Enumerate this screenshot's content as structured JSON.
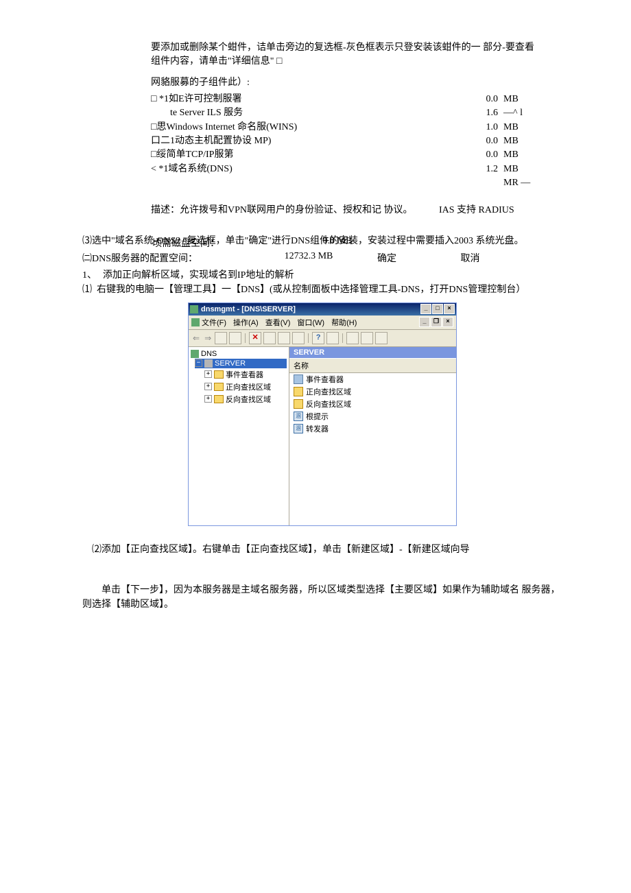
{
  "intro": {
    "p1": "要添加或删除某个蚶件，诘单击旁边的复选框-灰色框表示只登安装该蚶件的一 部分-要查看组件内容，请单击\"详细信息\" □",
    "p2": "网貉服募的子组件此）:"
  },
  "components": [
    {
      "label": "□ *1如E许可控制服署",
      "size": "0.0",
      "unit": "MB"
    },
    {
      "label": "　　te Server ILS 服务",
      "size": "1.6",
      "unit": "—^ l"
    },
    {
      "label": "□思Windows Internet 命名服(WINS)",
      "size": "1.0",
      "unit": "MB"
    },
    {
      "label": "口二1动态主机配置协设 MP)",
      "size": "0.0",
      "unit": "MB"
    },
    {
      "label": "□绥简单TCP/IP服第",
      "size": "0.0",
      "unit": "MB"
    },
    {
      "label": "< *1域名系统(DNS)",
      "size": "1.2",
      "unit": "MB"
    },
    {
      "label": "",
      "size": "",
      "unit": "MR —"
    }
  ],
  "desc": {
    "left": "描述：允许拨号和VPN联网用户的身份验证、授权和记 协议。",
    "right": "IAS 支持 RADIUS"
  },
  "step3": "⑶选中\"域名系统-ONS2 \"复选框，单击\"确定\"进行DNS组件的安装，安装过程中需要插入2003 系统光盘。",
  "diskReq": {
    "label": "顷需磁盘空间：",
    "val": "0.0 MB"
  },
  "diskCfg": {
    "label": "㈡DNS服务器的配置空间：",
    "val": "12732.3 MB"
  },
  "buttons": {
    "ok": "确定",
    "cancel": "取消"
  },
  "step1": {
    "num": "1、",
    "text": "添加正向解析区域，实现域名到IP地址的解析"
  },
  "sub1": "⑴ 右键我的电脑一【管理工具】一【DNS】(或从控制面板中选择管理工具-DNS，打开DNS管理控制台）",
  "app": {
    "title": "dnsmgmt - [DNS\\SERVER]",
    "menu": {
      "file": "文件(F)",
      "action": "操作(A)",
      "view": "查看(V)",
      "window": "窗口(W)",
      "help": "帮助(H)"
    },
    "tree": {
      "root": "DNS",
      "server": "SERVER",
      "nodes": [
        "事件查看器",
        "正向查找区域",
        "反向查找区域"
      ]
    },
    "list": {
      "header": "SERVER",
      "col": "名称",
      "items": [
        "事件查看器",
        "正向查找区域",
        "反向查找区域",
        "根提示",
        "转发器"
      ]
    }
  },
  "sub2": "⑵添加【正向查找区域】。右键单击【正向查找区域】，单击【新建区域】-【新建区域向导",
  "tail": "　　单击【下一步】，因为本服务器是主域名服务器，所以区域类型选择【主要区域】如果作为辅助域名 服务器，则选择【辅助区域】。"
}
